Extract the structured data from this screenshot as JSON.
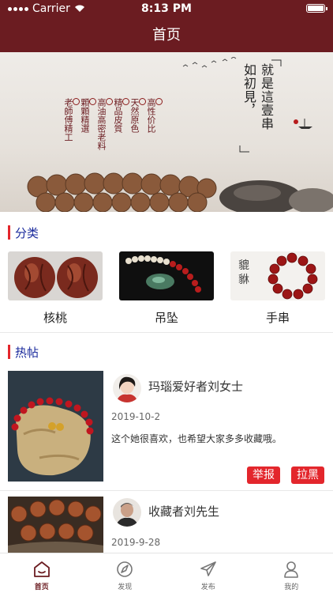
{
  "status_bar": {
    "carrier": "Carrier",
    "time": "8:13 PM"
  },
  "header": {
    "title": "首页"
  },
  "banner": {
    "slogan_lines": [
      "如初見，",
      "就是這壹串"
    ],
    "features": [
      "老師傅精工",
      "顆顆精選",
      "高油高密老料",
      "精品皮質",
      "天然原色",
      "高性价比"
    ]
  },
  "categories": {
    "heading": "分类",
    "items": [
      {
        "label": "核桃",
        "icon": "walnut-image"
      },
      {
        "label": "吊坠",
        "icon": "pendant-image"
      },
      {
        "label": "手串",
        "icon": "bracelet-image"
      }
    ]
  },
  "hot_posts": {
    "heading": "热帖",
    "posts": [
      {
        "author": "玛瑙爱好者刘女士",
        "date": "2019-10-2",
        "text": "这个她很喜欢，也希望大家多多收藏哦。",
        "report_label": "举报",
        "block_label": "拉黑"
      },
      {
        "author": "收藏者刘先生",
        "date": "2019-9-28"
      }
    ]
  },
  "tabbar": {
    "items": [
      {
        "label": "首页",
        "icon": "home-icon",
        "active": true
      },
      {
        "label": "发现",
        "icon": "discover-icon",
        "active": false
      },
      {
        "label": "发布",
        "icon": "publish-icon",
        "active": false
      },
      {
        "label": "我的",
        "icon": "profile-icon",
        "active": false
      }
    ]
  },
  "colors": {
    "header": "#6b1c21",
    "accent": "#e3262c",
    "section_label": "#1a2a9c"
  }
}
